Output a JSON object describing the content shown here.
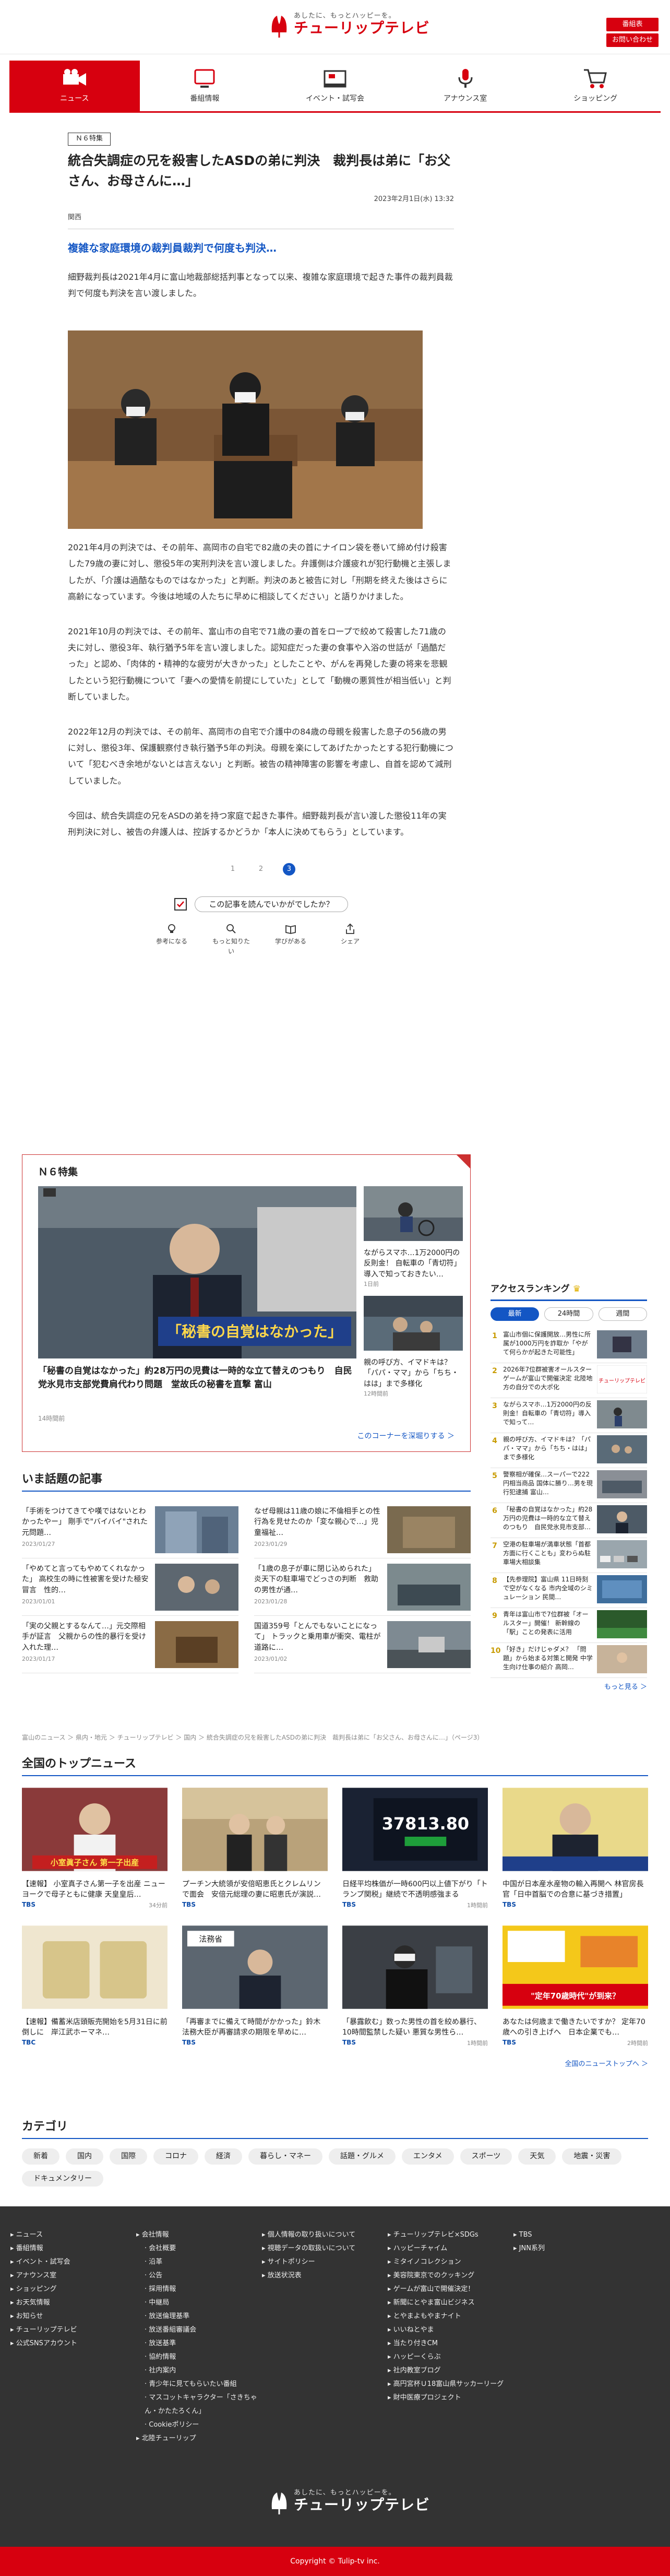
{
  "header": {
    "logo_tag": "あしたに、もっとハッピーを。",
    "logo_name": "チューリップテレビ",
    "btn_recruit": "番組表",
    "btn_contact": "お問い合わせ"
  },
  "nav": [
    {
      "label": "ニュース",
      "icon": "camera-icon",
      "active": true
    },
    {
      "label": "番組情報",
      "icon": "tv-icon",
      "active": false
    },
    {
      "label": "イベント・試写会",
      "icon": "event-icon",
      "active": false
    },
    {
      "label": "アナウンス室",
      "icon": "microphone-icon",
      "active": false
    },
    {
      "label": "ショッピング",
      "icon": "cart-icon",
      "active": false
    }
  ],
  "article": {
    "badge": "Ｎ６特集",
    "headline": "統合失調症の兄を殺害したASDの弟に判決　裁判長は弟に「お父さん、お母さんに…」",
    "date": "2023年2月1日(水) 13:32",
    "station": "関西",
    "subhead": "複雑な家庭環境の裁判員裁判で何度も判決…",
    "intro": "細野裁判長は2021年4月に富山地裁部総括判事となって以来、複雑な家庭環境で起きた事件の裁判員裁判で何度も判決を言い渡しました。",
    "paragraphs": [
      "2021年4月の判決では、その前年、高岡市の自宅で82歳の夫の首にナイロン袋を巻いて締め付け殺害した79歳の妻に対し、懲役5年の実刑判決を言い渡しました。弁護側は介護疲れが犯行動機と主張しましたが、「介護は過酷なものではなかった」と判断。判決のあと被告に対し「刑期を終えた後はさらに高齢になっています。今後は地域の人たちに早めに相談してください」と語りかけました。",
      "2021年10月の判決では、その前年、富山市の自宅で71歳の妻の首をロープで絞めて殺害した71歳の夫に対し、懲役3年、執行猶予5年を言い渡しました。認知症だった妻の食事や入浴の世話が「過酷だった」と認め、「肉体的・精神的な疲労が大きかった」としたことや、がんを再発した妻の将来を悲観したという犯行動機について「妻への愛情を前提にしていた」として「動機の悪質性が相当低い」と判断していました。",
      "2022年12月の判決では、その前年、高岡市の自宅で介護中の84歳の母親を殺害した息子の56歳の男に対し、懲役3年、保護観察付き執行猶予5年の判決。母親を楽にしてあげたかったとする犯行動機について「犯むべき余地がないとは言えない」と判断。被告の精神障害の影響を考慮し、自首を認めて減刑していました。",
      "今回は、統合失調症の兄をASDの弟を持つ家庭で起きた事件。細野裁判長が言い渡した懲役11年の実刑判決に対し、被告の弁護人は、控訴するかどうか「本人に決めてもらう」としています。"
    ],
    "pages": [
      "1",
      "2",
      "3"
    ],
    "question": "この記事を読んでいかがでしたか？",
    "reactions": [
      "参考になる",
      "もっと知りたい",
      "学びがある",
      "シェア"
    ]
  },
  "feature": {
    "title": "Ｎ６特集",
    "main_caption": "「秘書の自覚はなかった」",
    "main_title": "「秘書の自覚はなかった」約28万円の児費は一時的な立て替えのつもり　自民党氷見市支部党費肩代わり問題　堂故氏の秘書を直撃 富山",
    "main_ago": "14時間前",
    "side": [
      {
        "title": "ながらスマホ…1万2000円の反則金！ 自転車の「青切符」導入で知っておきたい…",
        "ago": "1日前"
      },
      {
        "title": "親の呼び方、イマドキは？「パパ・ママ」から「ちち・はは」まで多様化",
        "ago": "12時間前"
      }
    ],
    "more": "このコーナーを深堀りする ＞"
  },
  "ranking": {
    "title": "アクセスランキング",
    "tabs": [
      "最新",
      "24時間",
      "週間"
    ],
    "items": [
      {
        "n": "1",
        "text": "富山市個に保護開放…男性に所属が1000万円を詐取か「やがて何らかが起きた可能性」"
      },
      {
        "n": "2",
        "text": "2026年7位群被害オールスターゲームが富山で開催決定 北陸地方の自分での大ポ化"
      },
      {
        "n": "3",
        "text": "ながらスマホ…1万2000円の反則金！自転車の「青切符」導入で知って…"
      },
      {
        "n": "4",
        "text": "親の呼び方、イマドキは？「パパ・ママ」から「ちち・はは」まで多様化"
      },
      {
        "n": "5",
        "text": "警察相が確保…スーパーで222円相当商品 国体に勝り…男を現行犯逮捕 富山…"
      },
      {
        "n": "6",
        "text": "「秘書の自覚はなかった」約28万円の児費は一時的な立て替えのつもり　自民党氷見市支部…"
      },
      {
        "n": "7",
        "text": "空港の駐車場が満車状態「首都方面に行くことも」変わらぬ駐車場大相談集　"
      },
      {
        "n": "8",
        "text": "【先参理院】富山県 11日時刻で空がなくなる 市内全域のシミュレーション 民間…"
      },
      {
        "n": "9",
        "text": "青年は富山市で7位群被「オールスター」開催！ 新幹線の「駅」ことの発表に活用"
      },
      {
        "n": "10",
        "text": "「好き」だけじゃダメ？ 「問題」から始まる対策と開発 中学生向け仕事の紹介 高岡…"
      }
    ],
    "more": "もっと見る ＞"
  },
  "hot": {
    "title": "いま話題の記事",
    "items": [
      {
        "text": "「手術をつけてきてや嘆ではないとわかったやー」 剛手で\"バイバイ\"された元問題…",
        "date": "2023/01/27"
      },
      {
        "text": "なぜ母親は11歳の娘に不倫相手との性行為を見せたのか「変な親心で…」児童福祉…",
        "date": "2023/01/29"
      },
      {
        "text": "「やめてと言ってもやめてくれなかった」 高校生の時に性被害を受けた極安 冒言　性的…",
        "date": "2023/01/01"
      },
      {
        "text": "「1歳の息子が車に閉じ込められた」炎天下の駐車場でどっさの判断　救助の男性が通…",
        "date": "2023/01/28"
      },
      {
        "text": "「実の父親とするなんて…」元交際相手が証言　父親からの性的暴行を受け入れた理…",
        "date": "2023/01/17"
      },
      {
        "text": "国道359号「とんでもないことになって」 トラックと乗用車が衝突、電柱が道路に…",
        "date": "2023/01/02"
      }
    ]
  },
  "breadcrumb": "富山のニュース ＞ 県内・地元 ＞ チューリップテレビ ＞ 国内 ＞ 統合失調症の兄を殺害したASDの弟に判決　裁判長は弟に「お父さん、お母さんに…」（ページ3）",
  "national": {
    "title": "全国のトップニュース",
    "items": [
      {
        "title": "【速報】 小室真子さん第一子を出産 ニューヨークで母子ともに健康 天皇皇后…",
        "src": "TBS",
        "ago": "34分前",
        "caption": "小室眞子さん 第一子出産"
      },
      {
        "title": "プーチン大統領が安倍昭恵氏とクレムリンで面会　安倍元総理の妻に昭恵氏が演説…",
        "src": "TBS",
        "ago": "",
        "caption": ""
      },
      {
        "title": "日経平均株価が一時600円以上値下がり「トランプ関税」継続で不透明感強まる",
        "src": "TBS",
        "ago": "1時間前",
        "caption": "37813.80"
      },
      {
        "title": "中国が日本産水産物の輸入再開へ 林官房長官「日中首脳での合意に基づき措置」",
        "src": "TBS",
        "ago": "",
        "caption": ""
      },
      {
        "title": "【速報】備蓄米店頭販売開始を5月31日に前倒しに　岸江武ホーマネ…",
        "src": "TBC",
        "ago": "",
        "caption": ""
      },
      {
        "title": "「再審までに備えて時間がかかった」鈴木法務大臣が再審請求の期限を早めに…",
        "src": "TBS",
        "ago": "",
        "caption": "法務省"
      },
      {
        "title": "「暴露飲む」数った男性の首を絞め暴行、10時間監禁した疑い 悪質な男性ら…",
        "src": "TBS",
        "ago": "1時間前",
        "caption": ""
      },
      {
        "title": "あなたは何歳まで働きたいですか？ 定年70歳への引き上げへ　日本企業でも…",
        "src": "TBS",
        "ago": "2時間前",
        "caption": "\"定年70歳時代\"が到来？"
      }
    ],
    "more": "全国のニューストップへ ＞"
  },
  "categories": {
    "title": "カテゴリ",
    "items": [
      "新着",
      "国内",
      "国際",
      "コロナ",
      "経済",
      "暮らし・マネー",
      "話題・グルメ",
      "エンタメ",
      "スポーツ",
      "天気",
      "地震・災害",
      "ドキュメンタリー"
    ]
  },
  "footer": {
    "col1": [
      "ニュース",
      "番組情報",
      "イベント・試写会",
      "アナウンス室",
      "ショッピング",
      "お天気情報",
      "お知らせ",
      "チューリップテレビ",
      "公式SNSアカウント"
    ],
    "col2_head": "会社情報",
    "col2": [
      "会社概要",
      "沿革",
      "公告",
      "採用情報",
      "中継局",
      "放送倫理基準",
      "放送番組審議会",
      "放送基準",
      "協約情報",
      "社内案内",
      "青少年に見てもらいたい番組",
      "マスコットキャラクター「さきちゃん・かたたろくん」",
      "Cookieポリシー"
    ],
    "col2_tail": "北陸チューリップ",
    "col3": [
      "個人情報の取り扱いについて",
      "視聴データの取扱いについて",
      "サイトポリシー",
      "放送状況表"
    ],
    "col4": [
      "チューリップテレビ×SDGs",
      "ハッピーチャイム",
      "ミタイノコレクション",
      "美容院東京でのクッキング",
      "ゲームが富山で開催決定！",
      "新聞にとやま富山ビジネス",
      "とやまよもやまナイト",
      "いいねとやま",
      "当たり付きCM",
      "ハッピーくらぶ",
      "社内教室ブログ",
      "高円宮杯Ｕ18富山県サッカーリーグ",
      "財中医療プロジェクト"
    ],
    "col5": [
      "TBS",
      "JNN系列"
    ],
    "copyright": "Copyright © Tulip-tv inc."
  }
}
